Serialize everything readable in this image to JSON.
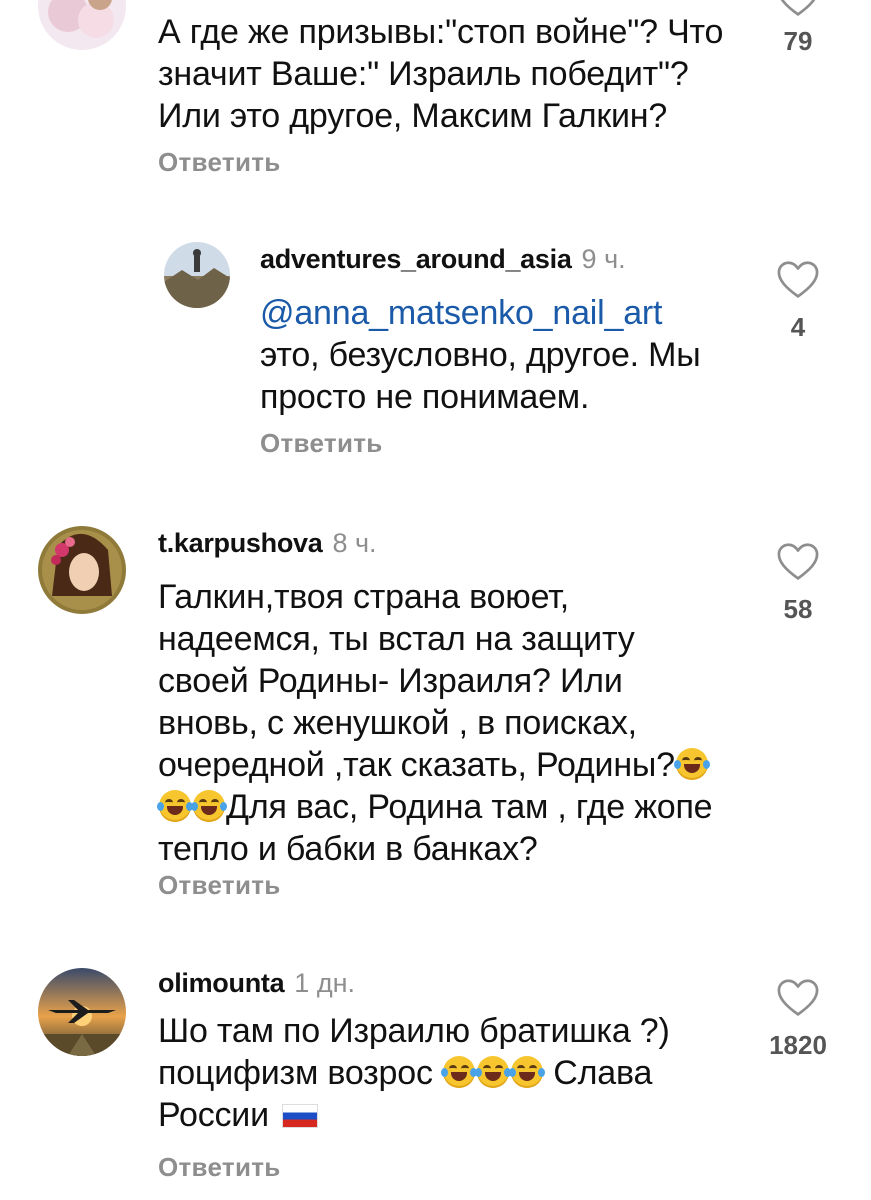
{
  "comments": [
    {
      "username": "",
      "time": "",
      "text_lines": [
        "А где же призывы:\"стоп войне\"? Что",
        "значит Ваше:\" Израиль победит\"?",
        "Или это другое, Максим Галкин?"
      ],
      "reply_label": "Ответить",
      "likes": "79",
      "avatar": "woman-flowers-avatar"
    },
    {
      "username": "adventures_around_asia",
      "time": "9 ч.",
      "mention": "@anna_matsenko_nail_art",
      "text_lines": [
        "это, безусловно, другое. Мы",
        "просто не понимаем."
      ],
      "reply_label": "Ответить",
      "likes": "4",
      "avatar": "hiker-mountain-avatar"
    },
    {
      "username": "t.karpushova",
      "time": "8 ч.",
      "text_lines": [
        "Галкин,твоя страна воюет,",
        "надеемся, ты встал на защиту",
        "своей Родины- Израиля? Или",
        "вновь, с женушкой , в поисках,",
        "очередной ,так сказать, Родины?",
        "Для вас, Родина там , где жопе",
        "тепло и бабки в банках?"
      ],
      "reply_label": "Ответить",
      "likes": "58",
      "avatar": "painted-girl-avatar"
    },
    {
      "username": "olimounta",
      "time": "1 дн.",
      "text_lines": [
        "Шо там по Израилю братишка ?)",
        "поцифизм возрос",
        "Слава",
        "России"
      ],
      "reply_label": "Ответить",
      "likes": "1820",
      "avatar": "airplane-sunset-avatar"
    }
  ],
  "icons": {
    "like": "heart-outline-icon",
    "emoji": "face-with-tears-of-joy",
    "flag": "russia-flag"
  },
  "colors": {
    "text": "#111111",
    "muted": "#8e8e8e",
    "mention": "#1a5aa8",
    "background": "#ffffff"
  }
}
